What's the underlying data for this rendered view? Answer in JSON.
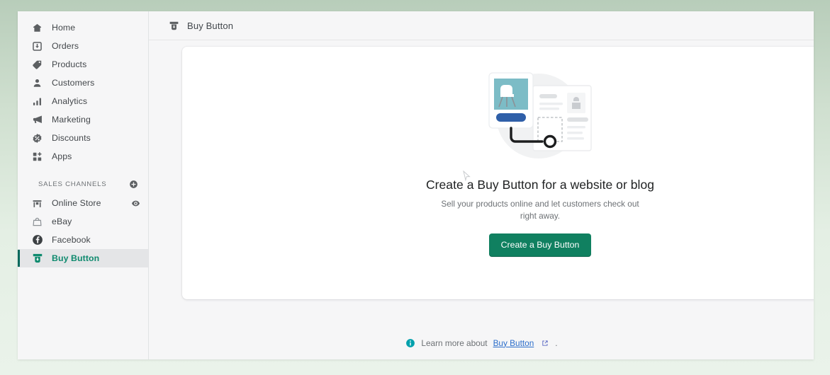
{
  "window": {
    "background_top": "#b8cdba",
    "background_bottom": "#eaf3ea"
  },
  "sidebar": {
    "main_items": [
      {
        "label": "Home",
        "icon": "home-icon"
      },
      {
        "label": "Orders",
        "icon": "orders-inbox-icon"
      },
      {
        "label": "Products",
        "icon": "products-tag-icon"
      },
      {
        "label": "Customers",
        "icon": "customers-person-icon"
      },
      {
        "label": "Analytics",
        "icon": "analytics-bar-chart-icon"
      },
      {
        "label": "Marketing",
        "icon": "marketing-megaphone-icon"
      },
      {
        "label": "Discounts",
        "icon": "discounts-percent-icon"
      },
      {
        "label": "Apps",
        "icon": "apps-grid-plus-icon"
      }
    ],
    "sales_channels": {
      "title": "SALES CHANNELS",
      "add_icon": "add-circle-icon",
      "items": [
        {
          "label": "Online Store",
          "icon": "online-store-icon",
          "trailing_icon": "eye-view-icon",
          "active": false
        },
        {
          "label": "eBay",
          "icon": "ebay-bag-icon",
          "trailing_icon": "",
          "active": false
        },
        {
          "label": "Facebook",
          "icon": "facebook-icon",
          "trailing_icon": "",
          "active": false
        },
        {
          "label": "Buy Button",
          "icon": "buy-button-icon",
          "trailing_icon": "",
          "active": true
        }
      ]
    },
    "active_color": "#0e8a6e",
    "active_bar_color": "#00695c"
  },
  "topbar": {
    "icon": "buy-button-icon",
    "title": "Buy Button"
  },
  "empty_state": {
    "illustration": "buy-button-embed-illustration",
    "title": "Create a Buy Button for a website or blog",
    "subtitle": "Sell your products online and let customers check out right away.",
    "cta_label": "Create a Buy Button",
    "cta_color": "#108060"
  },
  "footer": {
    "icon": "info-circle-icon",
    "text": "Learn more about",
    "link_label": "Buy Button",
    "external_icon": "external-link-icon",
    "trailing_period": ".",
    "link_color": "#2c6ecb"
  }
}
